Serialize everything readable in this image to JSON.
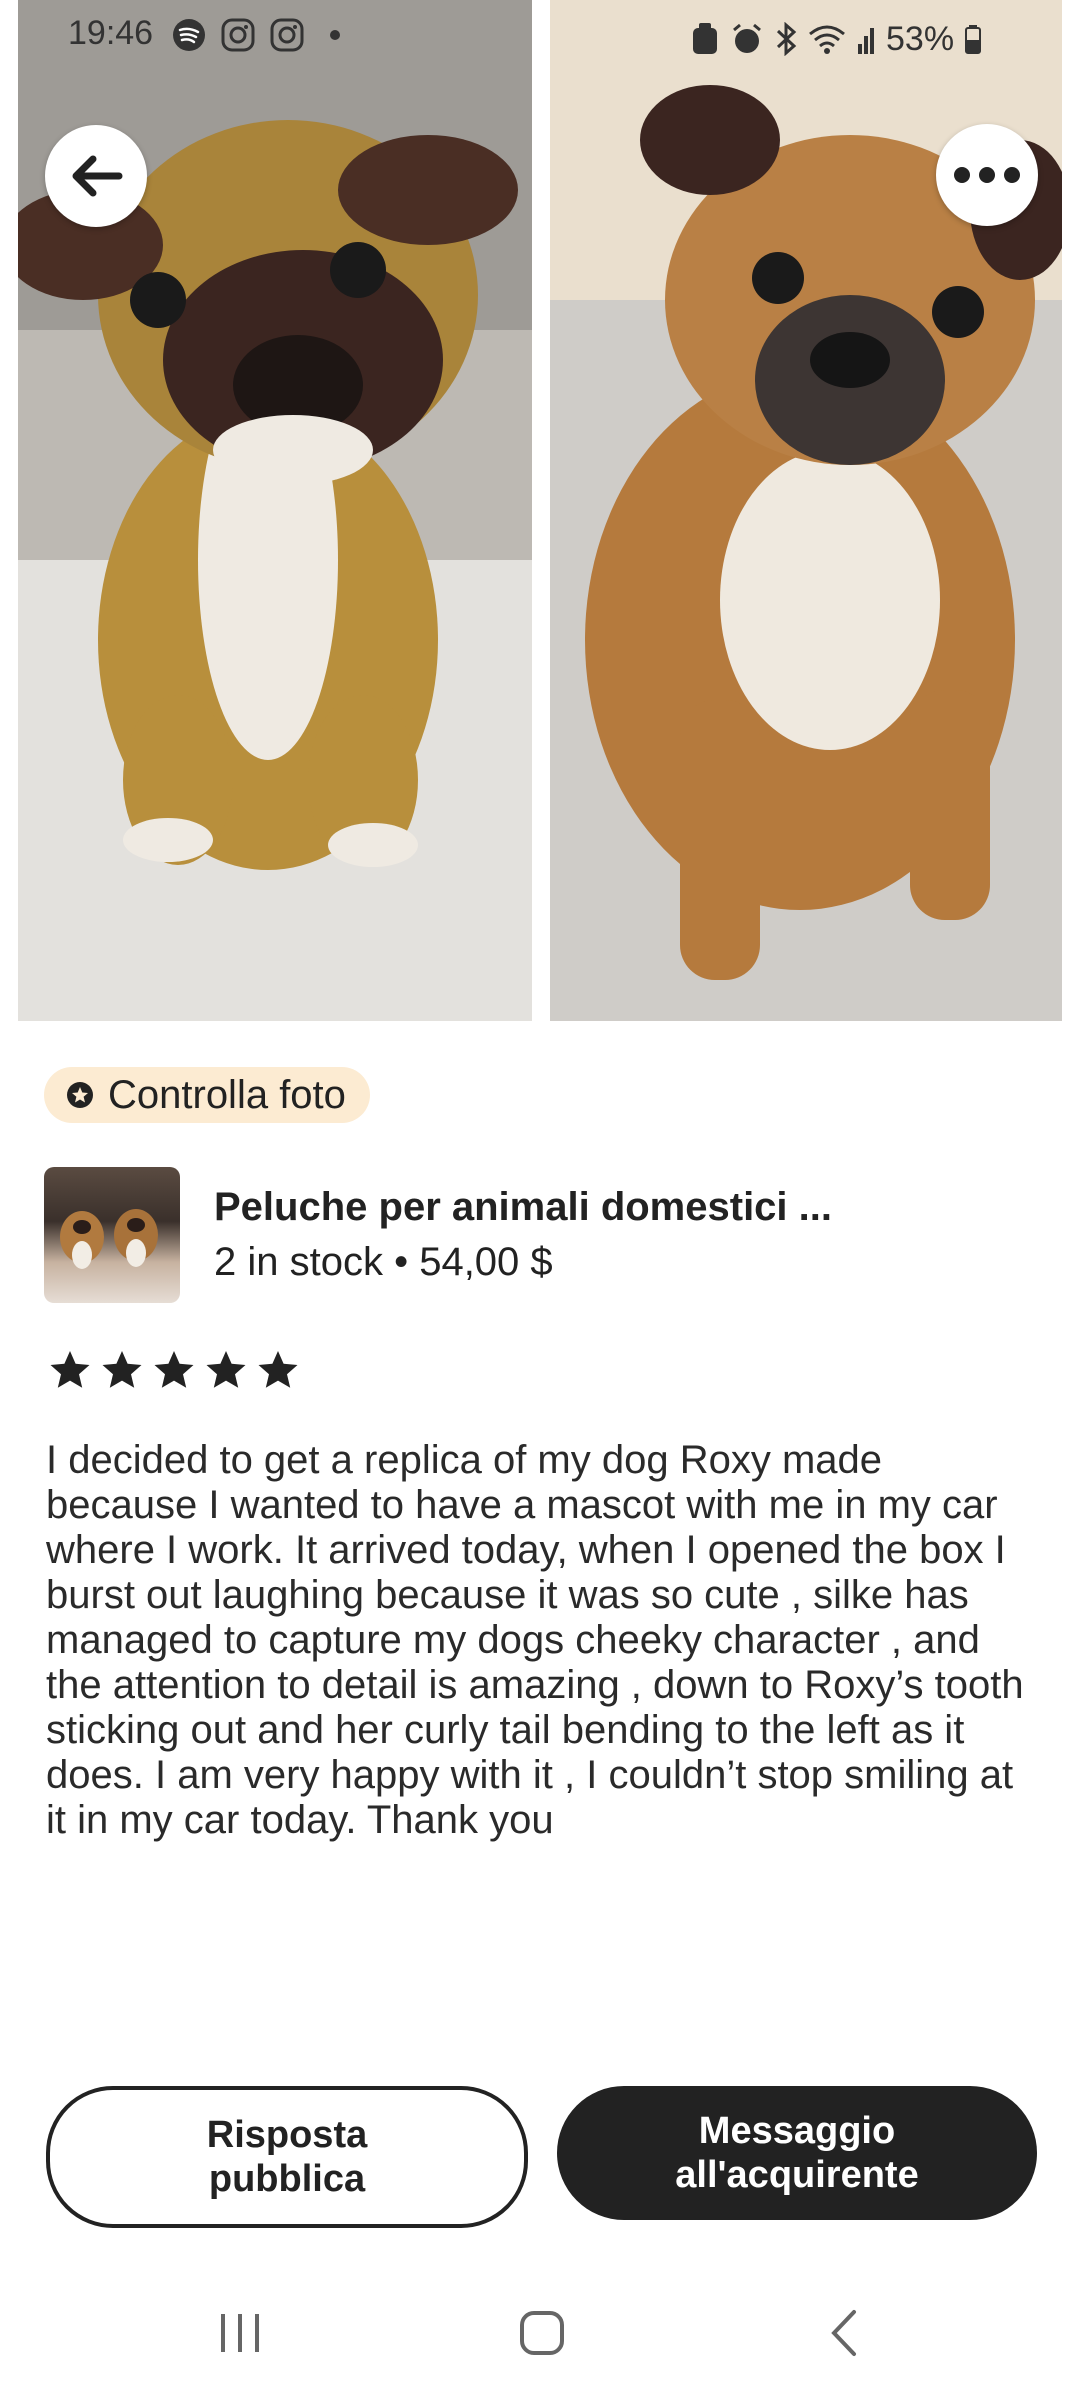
{
  "status_bar": {
    "time": "19:46",
    "left_icons": [
      "spotify-icon",
      "instagram-icon",
      "instagram-icon",
      "dot-icon"
    ],
    "right_icons": [
      "recycle-icon",
      "alarm-icon",
      "bluetooth-icon",
      "wifi-icon",
      "signal-icon"
    ],
    "battery": "53%"
  },
  "photos": {
    "left_alt": "crochet-pug-plush",
    "right_alt": "real-pug-dog"
  },
  "chip": {
    "icon": "star-badge-icon",
    "label": "Controlla foto"
  },
  "product": {
    "title": "Peluche per animali domestici ...",
    "meta": "2 in stock • 54,00 $"
  },
  "rating": {
    "stars": 5,
    "max": 5
  },
  "review": "I decided to get a replica of my dog Roxy made because I wanted to have a mascot with me in my car where I work. It arrived today, when I opened the box I burst out laughing because it was so cute , silke has managed to capture my dogs cheeky character , and the attention to detail is amazing , down to Roxy’s tooth sticking out and her curly tail bending to the left as it does. I am very happy with it , I couldn’t stop smiling at it in my car today. Thank you",
  "buttons": {
    "public_reply": {
      "line1": "Risposta",
      "line2": "pubblica"
    },
    "message_buyer": {
      "line1": "Messaggio",
      "line2": "all'acquirente"
    }
  },
  "colors": {
    "chip_bg": "#fcebd2",
    "dark": "#222222"
  }
}
